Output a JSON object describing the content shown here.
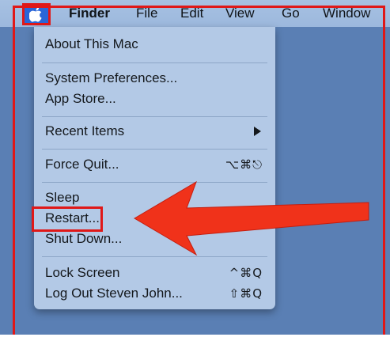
{
  "menubar": {
    "apple_icon": "apple-icon",
    "items": [
      "Finder",
      "File",
      "Edit",
      "View",
      "Go",
      "Window"
    ]
  },
  "apple_menu": {
    "items": [
      {
        "label": "About This Mac"
      },
      {
        "label": "System Preferences..."
      },
      {
        "label": "App Store..."
      },
      {
        "label": "Recent Items",
        "submenu_icon": "triangle-right-icon"
      },
      {
        "label": "Force Quit...",
        "shortcut": "⌥⌘⎋"
      },
      {
        "label": "Sleep"
      },
      {
        "label": "Restart..."
      },
      {
        "label": "Shut Down..."
      },
      {
        "label": "Lock Screen",
        "shortcut": "^⌘Q"
      },
      {
        "label": "Log Out Steven John...",
        "shortcut": "⇧⌘Q"
      }
    ]
  },
  "annotations": {
    "highlight_color": "#e01818",
    "arrow_color": "#f0321a",
    "arrow_target": "Restart..."
  },
  "colors": {
    "menubar": "#a7c1e2",
    "menu_background": "#b3c9e6",
    "desktop": "#5a7fb4",
    "apple_highlight": "#2a66d8"
  }
}
